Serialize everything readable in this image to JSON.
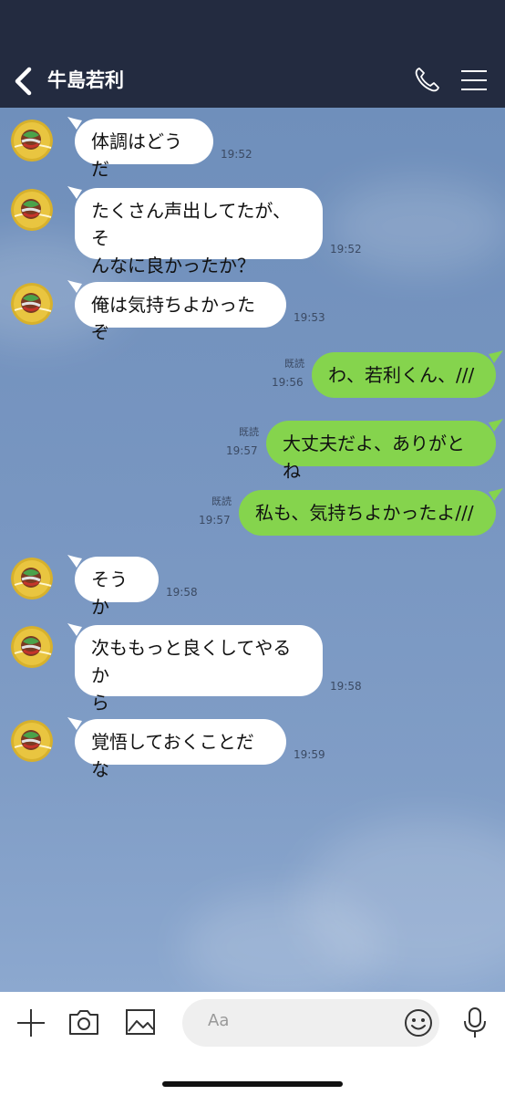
{
  "header": {
    "title": "牛島若利"
  },
  "messages": [
    {
      "side": "left",
      "text": "体調はどうだ",
      "time": "19:52"
    },
    {
      "side": "left",
      "text": "たくさん声出してたが、そ\nんなに良かったか？",
      "time": "19:52"
    },
    {
      "side": "left",
      "text": "俺は気持ちよかったぞ",
      "time": "19:53"
    },
    {
      "side": "right",
      "text": "わ、若利くん、///",
      "time": "19:56",
      "read": "既読"
    },
    {
      "side": "right",
      "text": "大丈夫だよ、ありがとね",
      "time": "19:57",
      "read": "既読"
    },
    {
      "side": "right",
      "text": "私も、気持ちよかったよ///",
      "time": "19:57",
      "read": "既読"
    },
    {
      "side": "left",
      "text": "そうか",
      "time": "19:58"
    },
    {
      "side": "left",
      "text": "次ももっと良くしてやるか\nら",
      "time": "19:58"
    },
    {
      "side": "left",
      "text": "覚悟しておくことだな",
      "time": "19:59"
    }
  ],
  "input": {
    "placeholder": "Aa"
  },
  "icons": {
    "back": "chevron-left-icon",
    "call": "phone-icon",
    "menu": "menu-icon",
    "add": "plus-icon",
    "camera": "camera-icon",
    "image": "image-icon",
    "emoji": "smiley-icon",
    "mic": "microphone-icon"
  },
  "colors": {
    "header": "#232b40",
    "bubble_own": "#85d44d",
    "bubble_other": "#ffffff",
    "chat_bg": "#7896c1"
  }
}
